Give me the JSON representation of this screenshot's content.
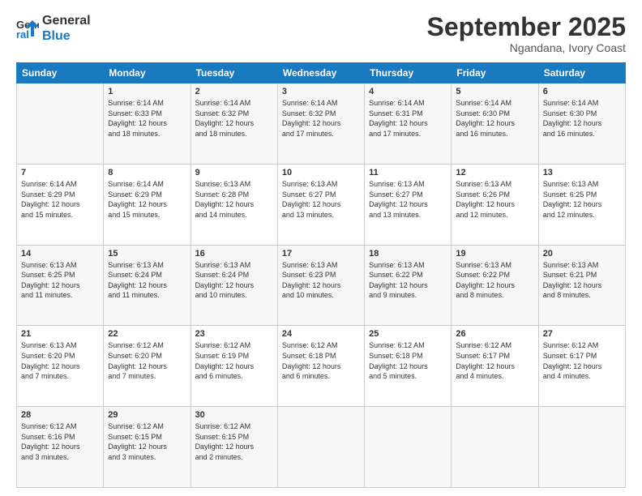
{
  "logo": {
    "line1": "General",
    "line2": "Blue"
  },
  "header": {
    "month": "September 2025",
    "location": "Ngandana, Ivory Coast"
  },
  "days": [
    "Sunday",
    "Monday",
    "Tuesday",
    "Wednesday",
    "Thursday",
    "Friday",
    "Saturday"
  ],
  "weeks": [
    [
      {
        "day": "",
        "info": ""
      },
      {
        "day": "1",
        "info": "Sunrise: 6:14 AM\nSunset: 6:33 PM\nDaylight: 12 hours\nand 18 minutes."
      },
      {
        "day": "2",
        "info": "Sunrise: 6:14 AM\nSunset: 6:32 PM\nDaylight: 12 hours\nand 18 minutes."
      },
      {
        "day": "3",
        "info": "Sunrise: 6:14 AM\nSunset: 6:32 PM\nDaylight: 12 hours\nand 17 minutes."
      },
      {
        "day": "4",
        "info": "Sunrise: 6:14 AM\nSunset: 6:31 PM\nDaylight: 12 hours\nand 17 minutes."
      },
      {
        "day": "5",
        "info": "Sunrise: 6:14 AM\nSunset: 6:30 PM\nDaylight: 12 hours\nand 16 minutes."
      },
      {
        "day": "6",
        "info": "Sunrise: 6:14 AM\nSunset: 6:30 PM\nDaylight: 12 hours\nand 16 minutes."
      }
    ],
    [
      {
        "day": "7",
        "info": "Sunrise: 6:14 AM\nSunset: 6:29 PM\nDaylight: 12 hours\nand 15 minutes."
      },
      {
        "day": "8",
        "info": "Sunrise: 6:14 AM\nSunset: 6:29 PM\nDaylight: 12 hours\nand 15 minutes."
      },
      {
        "day": "9",
        "info": "Sunrise: 6:13 AM\nSunset: 6:28 PM\nDaylight: 12 hours\nand 14 minutes."
      },
      {
        "day": "10",
        "info": "Sunrise: 6:13 AM\nSunset: 6:27 PM\nDaylight: 12 hours\nand 13 minutes."
      },
      {
        "day": "11",
        "info": "Sunrise: 6:13 AM\nSunset: 6:27 PM\nDaylight: 12 hours\nand 13 minutes."
      },
      {
        "day": "12",
        "info": "Sunrise: 6:13 AM\nSunset: 6:26 PM\nDaylight: 12 hours\nand 12 minutes."
      },
      {
        "day": "13",
        "info": "Sunrise: 6:13 AM\nSunset: 6:25 PM\nDaylight: 12 hours\nand 12 minutes."
      }
    ],
    [
      {
        "day": "14",
        "info": "Sunrise: 6:13 AM\nSunset: 6:25 PM\nDaylight: 12 hours\nand 11 minutes."
      },
      {
        "day": "15",
        "info": "Sunrise: 6:13 AM\nSunset: 6:24 PM\nDaylight: 12 hours\nand 11 minutes."
      },
      {
        "day": "16",
        "info": "Sunrise: 6:13 AM\nSunset: 6:24 PM\nDaylight: 12 hours\nand 10 minutes."
      },
      {
        "day": "17",
        "info": "Sunrise: 6:13 AM\nSunset: 6:23 PM\nDaylight: 12 hours\nand 10 minutes."
      },
      {
        "day": "18",
        "info": "Sunrise: 6:13 AM\nSunset: 6:22 PM\nDaylight: 12 hours\nand 9 minutes."
      },
      {
        "day": "19",
        "info": "Sunrise: 6:13 AM\nSunset: 6:22 PM\nDaylight: 12 hours\nand 8 minutes."
      },
      {
        "day": "20",
        "info": "Sunrise: 6:13 AM\nSunset: 6:21 PM\nDaylight: 12 hours\nand 8 minutes."
      }
    ],
    [
      {
        "day": "21",
        "info": "Sunrise: 6:13 AM\nSunset: 6:20 PM\nDaylight: 12 hours\nand 7 minutes."
      },
      {
        "day": "22",
        "info": "Sunrise: 6:12 AM\nSunset: 6:20 PM\nDaylight: 12 hours\nand 7 minutes."
      },
      {
        "day": "23",
        "info": "Sunrise: 6:12 AM\nSunset: 6:19 PM\nDaylight: 12 hours\nand 6 minutes."
      },
      {
        "day": "24",
        "info": "Sunrise: 6:12 AM\nSunset: 6:18 PM\nDaylight: 12 hours\nand 6 minutes."
      },
      {
        "day": "25",
        "info": "Sunrise: 6:12 AM\nSunset: 6:18 PM\nDaylight: 12 hours\nand 5 minutes."
      },
      {
        "day": "26",
        "info": "Sunrise: 6:12 AM\nSunset: 6:17 PM\nDaylight: 12 hours\nand 4 minutes."
      },
      {
        "day": "27",
        "info": "Sunrise: 6:12 AM\nSunset: 6:17 PM\nDaylight: 12 hours\nand 4 minutes."
      }
    ],
    [
      {
        "day": "28",
        "info": "Sunrise: 6:12 AM\nSunset: 6:16 PM\nDaylight: 12 hours\nand 3 minutes."
      },
      {
        "day": "29",
        "info": "Sunrise: 6:12 AM\nSunset: 6:15 PM\nDaylight: 12 hours\nand 3 minutes."
      },
      {
        "day": "30",
        "info": "Sunrise: 6:12 AM\nSunset: 6:15 PM\nDaylight: 12 hours\nand 2 minutes."
      },
      {
        "day": "",
        "info": ""
      },
      {
        "day": "",
        "info": ""
      },
      {
        "day": "",
        "info": ""
      },
      {
        "day": "",
        "info": ""
      }
    ]
  ]
}
